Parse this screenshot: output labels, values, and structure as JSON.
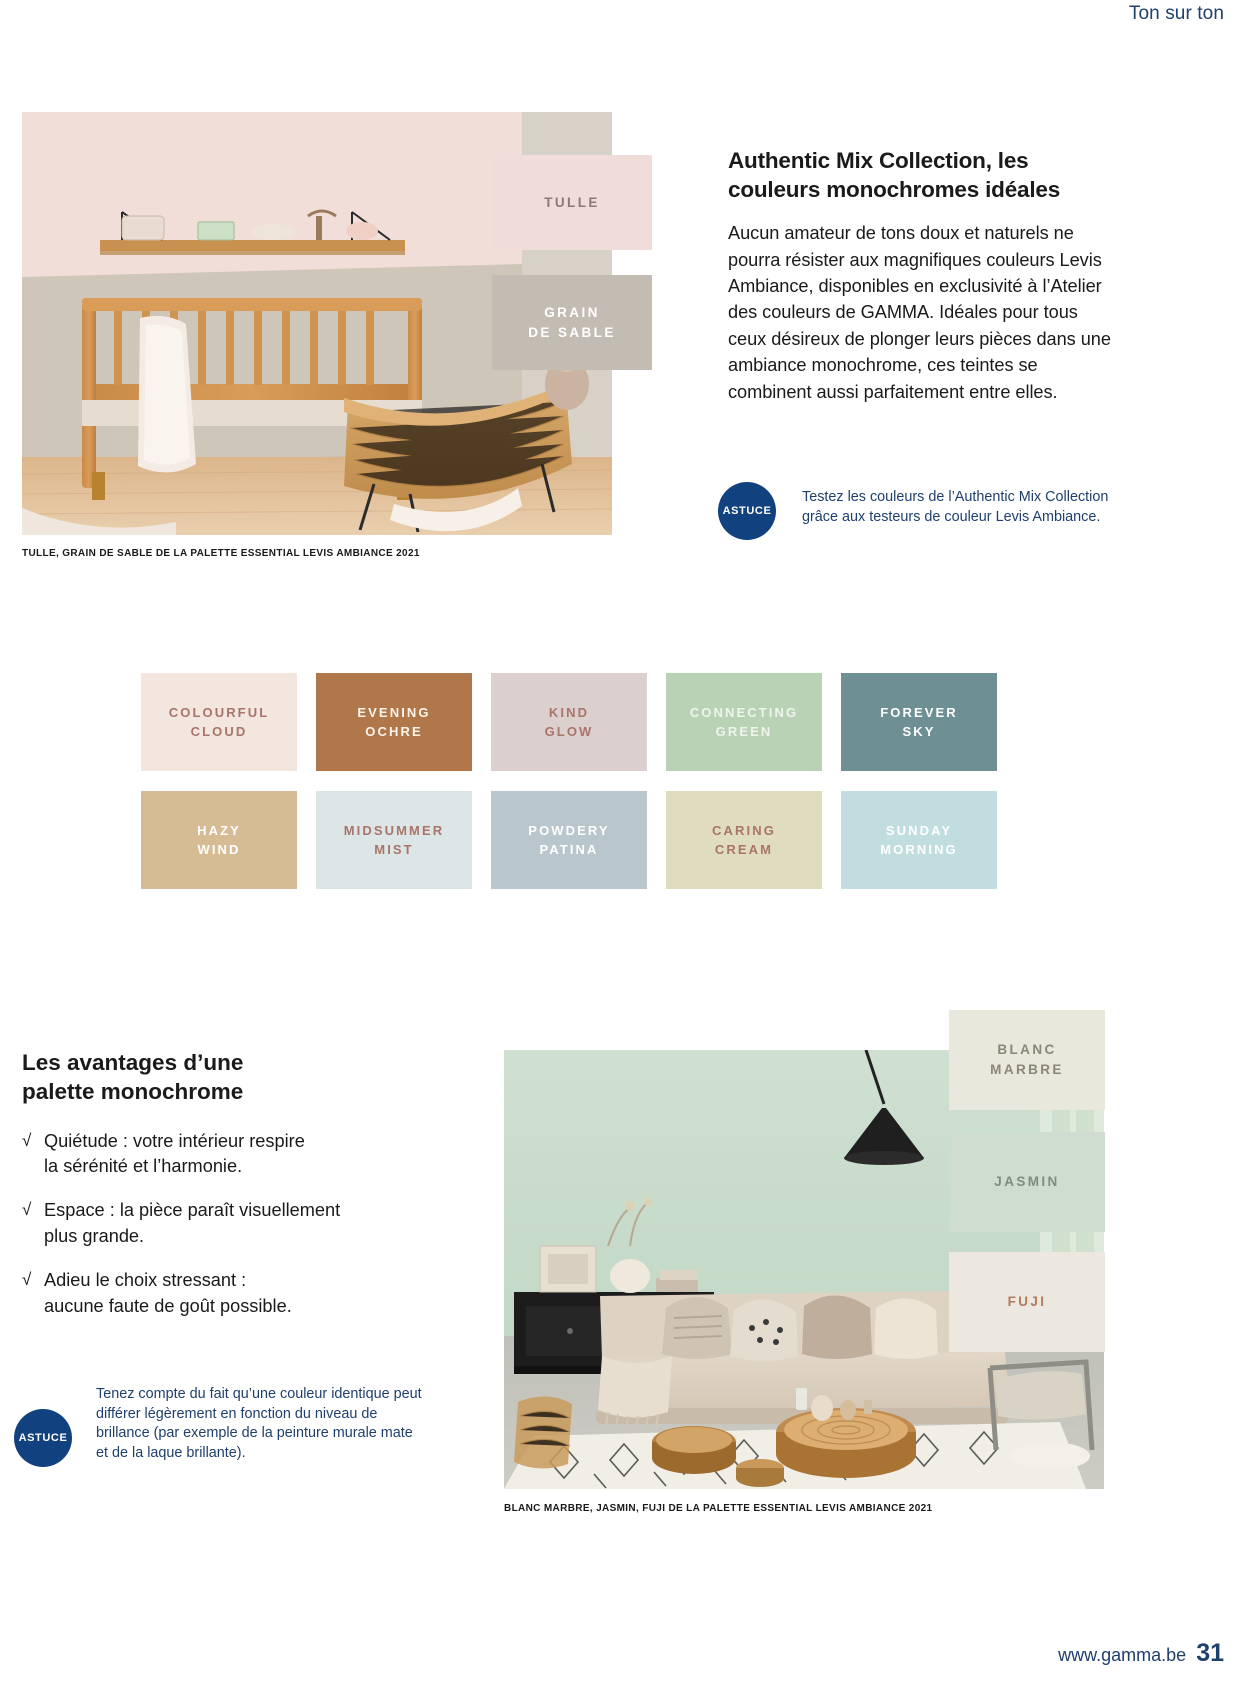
{
  "header": {
    "running_title": "Ton sur ton"
  },
  "hero": {
    "caption": "TULLE, GRAIN DE SABLE DE LA PALETTE ESSENTIAL LEVIS AMBIANCE 2021",
    "swatches": [
      {
        "name": "TULLE",
        "hex": "#f0dcd9",
        "text_hex": "#8c7a76"
      },
      {
        "name": "GRAIN\nDE SABLE",
        "line1": "GRAIN",
        "line2": "DE SABLE",
        "hex": "#c3bcb3",
        "text_hex": "#ffffff"
      }
    ]
  },
  "article": {
    "title_line1": "Authentic Mix Collection, les",
    "title_line2": "couleurs monochromes idéales",
    "body": "Aucun amateur de tons doux et naturels ne pourra résister aux magnifiques couleurs Levis Ambiance, disponibles en exclusivité à l’Atelier des couleurs de GAMMA. Idéales pour tous ceux désireux de plonger leurs pièces dans une ambiance monochrome, ces teintes se combinent aussi parfaitement entre elles."
  },
  "astuce_top": {
    "badge": "ASTUCE",
    "text": "Testez les couleurs de l’Authentic Mix Collection grâce aux testeurs de couleur Levis Ambiance."
  },
  "astuce_bottom": {
    "badge": "ASTUCE",
    "text": "Tenez compte du fait qu’une couleur identique peut différer légèrement en fonction du niveau de brillance (par exemple de la peinture murale mate et de la laque brillante)."
  },
  "palette": {
    "chips": [
      {
        "line1": "COLOURFUL",
        "line2": "CLOUD",
        "hex": "#f2e6de",
        "text_hex": "#a9746a"
      },
      {
        "line1": "EVENING",
        "line2": "OCHRE",
        "hex": "#b0774a",
        "text_hex": "#fdf4ea"
      },
      {
        "line1": "KIND",
        "line2": "GLOW",
        "hex": "#dcd0ce",
        "text_hex": "#a9746a"
      },
      {
        "line1": "CONNECTING",
        "line2": "GREEN",
        "hex": "#b9d2b6",
        "text_hex": "#eef5ec"
      },
      {
        "line1": "FOREVER",
        "line2": "SKY",
        "hex": "#6e9095",
        "text_hex": "#ffffff"
      },
      {
        "line1": "HAZY",
        "line2": "WIND",
        "hex": "#d5bc95",
        "text_hex": "#ffffff"
      },
      {
        "line1": "MIDSUMMER",
        "line2": "MIST",
        "hex": "#dce6e6",
        "text_hex": "#a9746a"
      },
      {
        "line1": "POWDERY",
        "line2": "PATINA",
        "hex": "#b9c6ce",
        "text_hex": "#ffffff"
      },
      {
        "line1": "CARING",
        "line2": "CREAM",
        "hex": "#e0dcc0",
        "text_hex": "#a9746a"
      },
      {
        "line1": "SUNDAY",
        "line2": "MORNING",
        "hex": "#c2dde0",
        "text_hex": "#ffffff"
      }
    ]
  },
  "advantages": {
    "title_line1": "Les avantages d’une",
    "title_line2": "palette monochrome",
    "check_glyph": "√",
    "items": [
      {
        "line1": "Quiétude : votre intérieur respire",
        "line2": "la sérénité et l’harmonie."
      },
      {
        "line1": "Espace : la pièce paraît visuellement",
        "line2": "plus grande."
      },
      {
        "line1": "Adieu le choix stressant :",
        "line2": "aucune faute de goût possible."
      }
    ]
  },
  "room": {
    "caption": "BLANC MARBRE, JASMIN, FUJI DE LA PALETTE ESSENTIAL LEVIS AMBIANCE 2021",
    "swatches": [
      {
        "line1": "BLANC",
        "line2": "MARBRE",
        "hex": "#e9e8dc",
        "text_hex": "#8b8776"
      },
      {
        "line1": "JASMIN",
        "line2": "",
        "hex": "#cfdcd0",
        "text_hex": "#7d8d7e"
      },
      {
        "line1": "FUJI",
        "line2": "",
        "hex": "#ece8e0",
        "text_hex": "#b07b5e"
      }
    ]
  },
  "footer": {
    "url": "www.gamma.be",
    "page_number": "31"
  },
  "brand": {
    "accent_blue": "#12417f",
    "heading_blue": "#1f3f6e"
  }
}
